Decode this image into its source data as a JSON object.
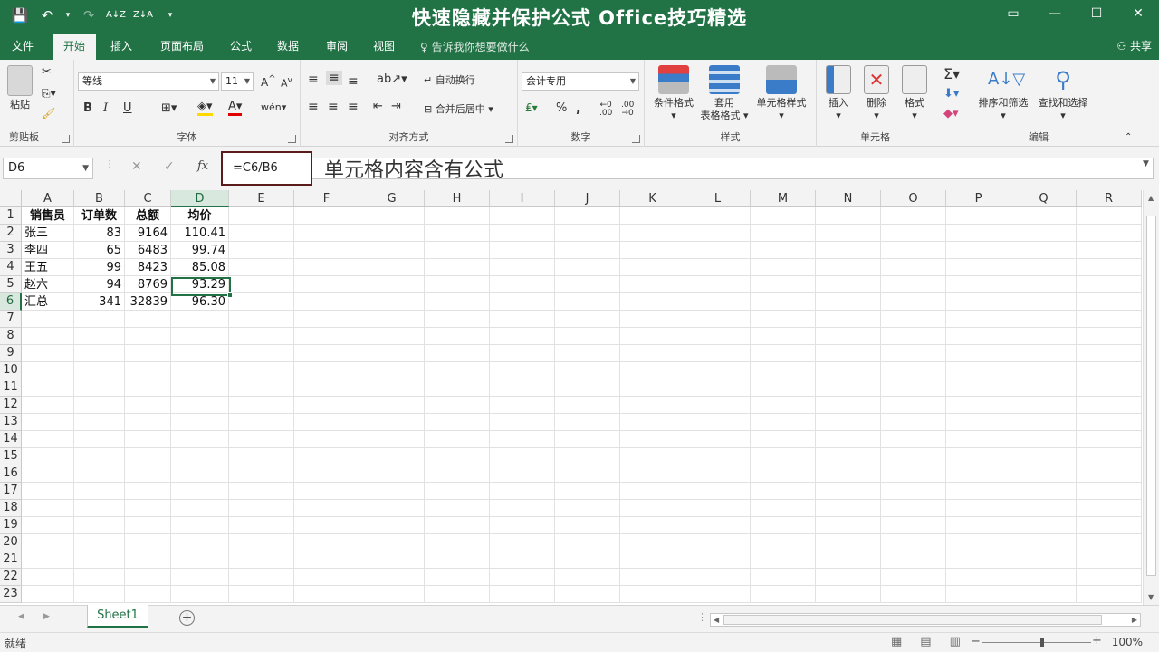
{
  "window": {
    "title": "快速隐藏并保护公式  Office技巧精选",
    "qat": [
      "💾",
      "↶",
      "▾",
      "↷",
      "A↓Z",
      "Z↓A",
      "▾"
    ],
    "controls": [
      "▭",
      "—",
      "☐",
      "✕"
    ]
  },
  "tabs": [
    "文件",
    "开始",
    "插入",
    "页面布局",
    "公式",
    "数据",
    "审阅",
    "视图"
  ],
  "active_tab": "开始",
  "tell_me": "告诉我你想要做什么",
  "share": "共享",
  "ribbon": {
    "clipboard": {
      "paste": "粘贴",
      "label": "剪贴板"
    },
    "font": {
      "name": "等线",
      "size": "11",
      "bold": "B",
      "italic": "I",
      "underline": "U",
      "label": "字体"
    },
    "alignment": {
      "wrap": "自动换行",
      "merge": "合并后居中",
      "label": "对齐方式"
    },
    "number": {
      "format": "会计专用",
      "percent": "%",
      "comma": ",",
      "label": "数字"
    },
    "styles": {
      "conditional": "条件格式",
      "table_1": "套用",
      "table_2": "表格格式",
      "cell_styles": "单元格样式",
      "label": "样式"
    },
    "cells": {
      "insert": "插入",
      "delete": "删除",
      "format": "格式",
      "label": "单元格"
    },
    "editing": {
      "sort": "排序和筛选",
      "find": "查找和选择",
      "label": "编辑"
    }
  },
  "formula_bar": {
    "name_box": "D6",
    "fx": "fx",
    "formula": "=C6/B6",
    "annotation": "单元格内容含有公式"
  },
  "columns": [
    "A",
    "B",
    "C",
    "D",
    "E",
    "F",
    "G",
    "H",
    "I",
    "J",
    "K",
    "L",
    "M",
    "N",
    "O",
    "P",
    "Q",
    "R"
  ],
  "rows": [
    "1",
    "2",
    "3",
    "4",
    "5",
    "6",
    "7",
    "8",
    "9",
    "10",
    "11",
    "12",
    "13",
    "14",
    "15",
    "16",
    "17",
    "18",
    "19",
    "20",
    "21",
    "22",
    "23"
  ],
  "table": {
    "header": [
      "销售员",
      "订单数",
      "总额",
      "均价"
    ],
    "rows": [
      [
        "张三",
        "83",
        "9164",
        "110.41"
      ],
      [
        "李四",
        "65",
        "6483",
        "99.74"
      ],
      [
        "王五",
        "99",
        "8423",
        "85.08"
      ],
      [
        "赵六",
        "94",
        "8769",
        "93.29"
      ],
      [
        "汇总",
        "341",
        "32839",
        "96.30"
      ]
    ]
  },
  "sheets": [
    "Sheet1"
  ],
  "status": {
    "ready": "就绪",
    "zoom": "100%"
  },
  "colors": {
    "accent": "#217346"
  }
}
